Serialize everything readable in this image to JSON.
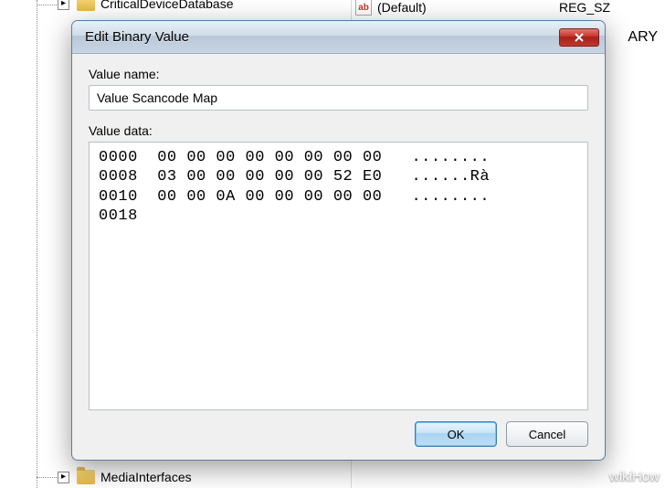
{
  "background": {
    "tree": {
      "top_item": "CriticalDeviceDatabase",
      "bottom_item": "MediaInterfaces"
    },
    "values": {
      "default_name": "(Default)",
      "default_type": "REG_SZ",
      "icon_text": "ab"
    },
    "truncated_text": "ARY"
  },
  "dialog": {
    "title": "Edit Binary Value",
    "value_name_label": "Value name:",
    "value_name": "Value Scancode Map",
    "value_data_label": "Value data:",
    "hex_lines": "0000  00 00 00 00 00 00 00 00   ........\n0008  03 00 00 00 00 00 52 E0   ......Rà\n0010  00 00 0A 00 00 00 00 00   ........\n0018",
    "ok": "OK",
    "cancel": "Cancel"
  },
  "watermark": "wikiHow"
}
